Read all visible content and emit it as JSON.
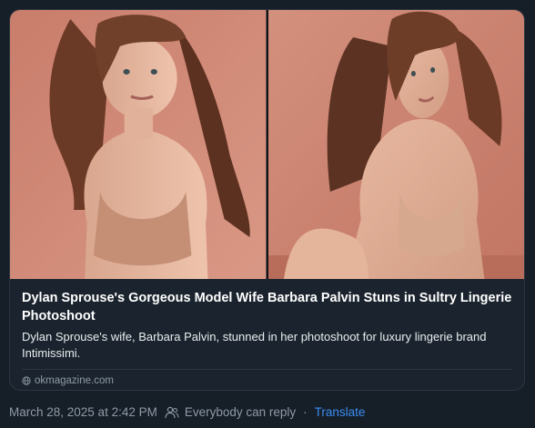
{
  "post": {
    "link_card": {
      "title": "Dylan Sprouse's Gorgeous Model Wife Barbara Palvin Stuns in Sultry Lingerie Photoshoot",
      "description": "Dylan Sprouse's wife, Barbara Palvin, stunned in her photoshoot for luxury lingerie brand Intimissimi.",
      "domain": "okmagazine.com",
      "domain_icon": "globe-icon"
    },
    "timestamp": "March 28, 2025 at 2:42 PM",
    "reply_setting": "Everybody can reply",
    "reply_icon": "people-icon",
    "separator": "·",
    "translate_label": "Translate",
    "colors": {
      "background": "#161e27",
      "card_border": "#2c3641",
      "muted_text": "#8e9aa6",
      "link": "#3b8ef3",
      "photo_backdrop": "#d08a78"
    }
  }
}
